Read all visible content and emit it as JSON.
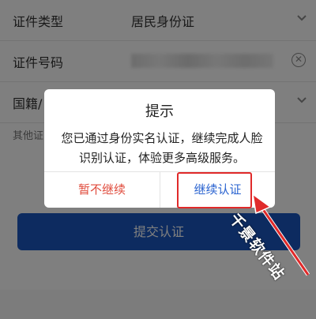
{
  "form": {
    "id_type_label": "证件类型",
    "id_type_value": "居民身份证",
    "id_number_label": "证件号码",
    "nationality_label": "国籍/",
    "other_text": "其他证",
    "submit_label": "提交认证"
  },
  "dialog": {
    "title": "提示",
    "message": "您已通过身份实名认证，继续完成人脸识别认证，体验更多高级服务。",
    "cancel_label": "暂不继续",
    "continue_label": "继续认证"
  },
  "watermark": {
    "text": "千景软件站"
  },
  "colors": {
    "primary": "#1a57c0",
    "cancel_text": "#e04b3c",
    "continue_text": "#2a63d0",
    "highlight": "#e02a2a"
  },
  "icons": {
    "clear": "clear-circle-icon",
    "dropdown": "chevron-down-icon",
    "arrow": "annotation-arrow-icon"
  }
}
